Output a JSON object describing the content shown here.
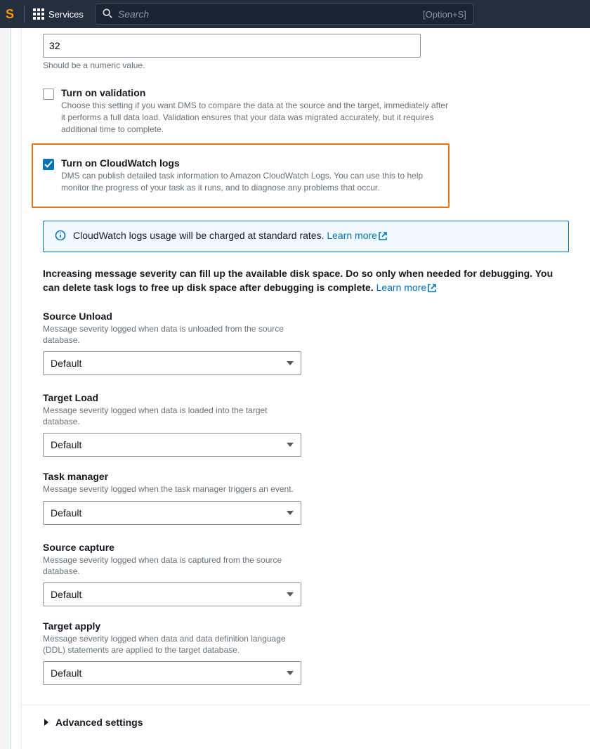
{
  "topnav": {
    "services_label": "Services",
    "search_placeholder": "Search",
    "search_shortcut": "[Option+S]"
  },
  "form": {
    "numeric_value": "32",
    "numeric_hint": "Should be a numeric value.",
    "validation": {
      "label": "Turn on validation",
      "desc": "Choose this setting if you want DMS to compare the data at the source and the target, immediately after it performs a full data load. Validation ensures that your data was migrated accurately, but it requires additional time to complete."
    },
    "cloudwatch": {
      "label": "Turn on CloudWatch logs",
      "desc": "DMS can publish detailed task information to Amazon CloudWatch Logs. You can use this to help monitor the progress of your task as it runs, and to diagnose any problems that occur."
    },
    "info_banner": {
      "text": "CloudWatch logs usage will be charged at standard rates. ",
      "link": "Learn more"
    },
    "severity_para": {
      "text": "Increasing message severity can fill up the available disk space. Do so only when needed for debugging. You can delete task logs to free up disk space after debugging is complete. ",
      "link": "Learn more"
    },
    "selects": {
      "source_unload": {
        "label": "Source Unload",
        "desc": "Message severity logged when data is unloaded from the source database.",
        "value": "Default"
      },
      "target_load": {
        "label": "Target Load",
        "desc": "Message severity logged when data is loaded into the target database.",
        "value": "Default"
      },
      "task_manager": {
        "label": "Task manager",
        "desc": "Message severity logged when the task manager triggers an event.",
        "value": "Default"
      },
      "source_capture": {
        "label": "Source capture",
        "desc": "Message severity logged when data is captured from the source database.",
        "value": "Default"
      },
      "target_apply": {
        "label": "Target apply",
        "desc": "Message severity logged when data and data definition language (DDL) statements are applied to the target database.",
        "value": "Default"
      }
    },
    "advanced_label": "Advanced settings"
  }
}
